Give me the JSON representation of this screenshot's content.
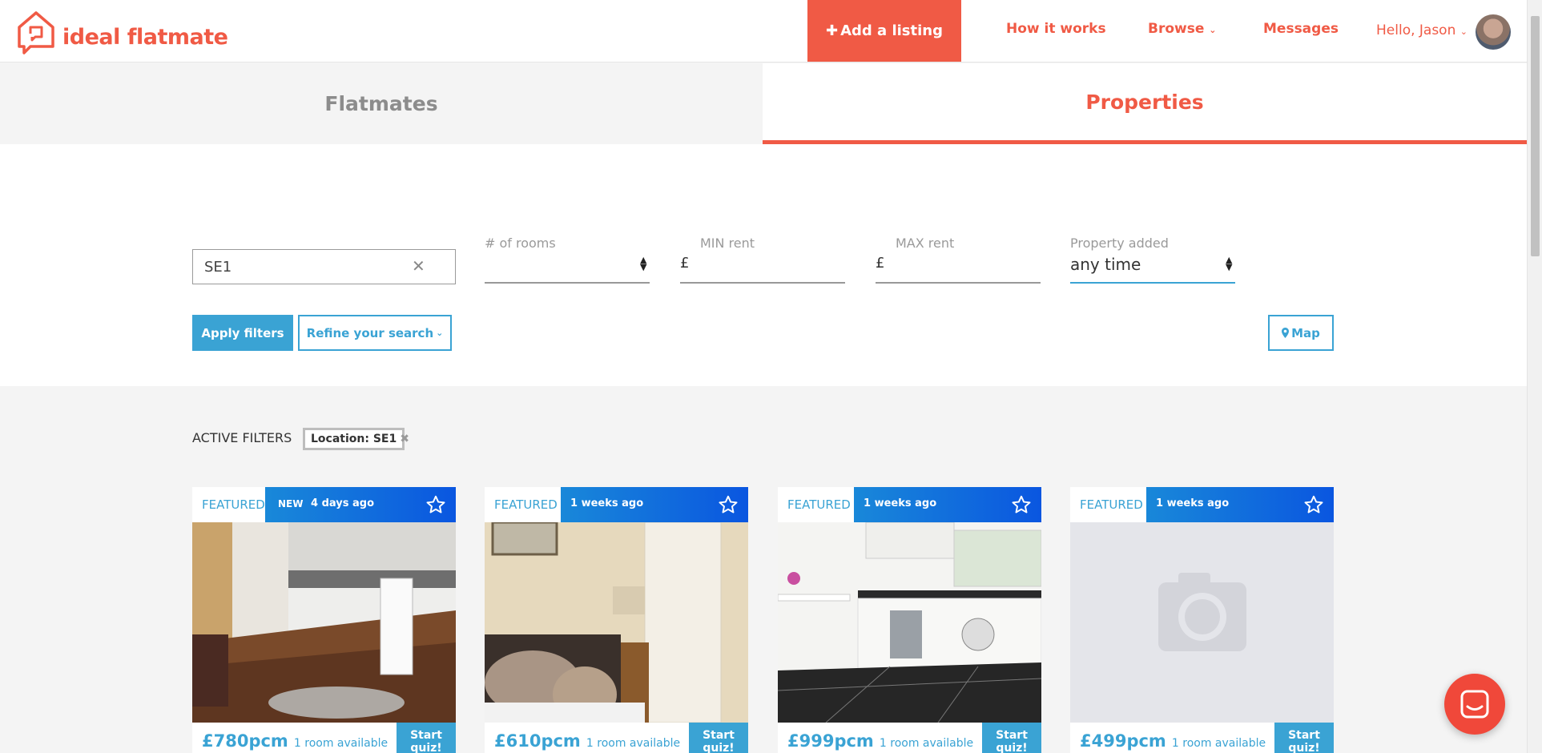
{
  "header": {
    "brand": "ideal flatmate",
    "add_listing": "Add a listing",
    "nav": {
      "how_it_works": "How it works",
      "browse": "Browse",
      "messages": "Messages"
    },
    "greeting": "Hello, Jason"
  },
  "tabs": {
    "flatmates": "Flatmates",
    "properties": "Properties"
  },
  "filters": {
    "location_value": "SE1",
    "rooms_label": "# of rooms",
    "min_rent_label": "MIN rent",
    "max_rent_label": "MAX rent",
    "currency": "£",
    "property_added_label": "Property added",
    "property_added_value": "any time",
    "apply": "Apply filters",
    "refine": "Refine your search",
    "map": "Map"
  },
  "active_filters": {
    "label": "ACTIVE FILTERS",
    "chip": "Location: SE1"
  },
  "cards": [
    {
      "featured": "FEATURED",
      "badge": "NEW",
      "age": "4 days ago",
      "price": "£780pcm",
      "rooms": "1 room available",
      "quiz": "Start quiz!"
    },
    {
      "featured": "FEATURED",
      "badge": "",
      "age": "1 weeks ago",
      "price": "£610pcm",
      "rooms": "1 room available",
      "quiz": "Start quiz!"
    },
    {
      "featured": "FEATURED",
      "badge": "",
      "age": "1 weeks ago",
      "price": "£999pcm",
      "rooms": "1 room available",
      "quiz": "Start quiz!"
    },
    {
      "featured": "FEATURED",
      "badge": "",
      "age": "1 weeks ago",
      "price": "£499pcm",
      "rooms": "1 room available",
      "quiz": "Start quiz!"
    }
  ],
  "colors": {
    "brand": "#f05a45",
    "accent": "#3aa3d4"
  }
}
